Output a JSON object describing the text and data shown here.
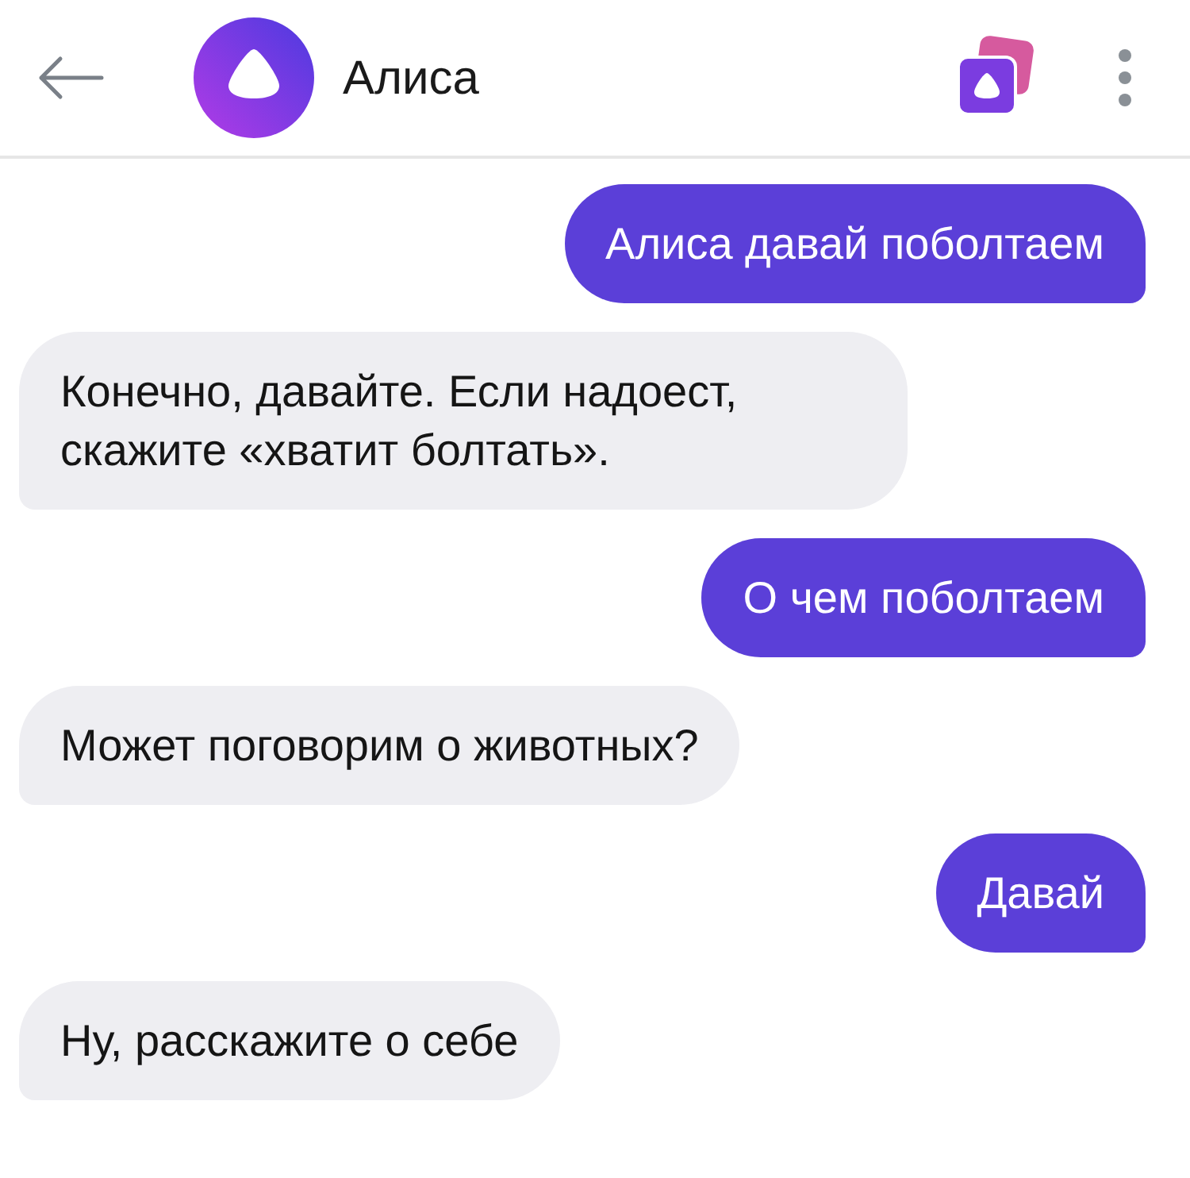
{
  "header": {
    "title": "Алиса"
  },
  "messages": [
    {
      "kind": "user",
      "text": "Алиса давай поболтаем"
    },
    {
      "kind": "assistant",
      "text": "Конечно, давайте. Если надоест, скажите «хватит болтать»."
    },
    {
      "kind": "user",
      "text": "О чем поболтаем"
    },
    {
      "kind": "assistant",
      "text": "Может поговорим о животных?"
    },
    {
      "kind": "user",
      "text": "Давай"
    },
    {
      "kind": "assistant",
      "text": "Ну, расскажите о себе"
    }
  ]
}
